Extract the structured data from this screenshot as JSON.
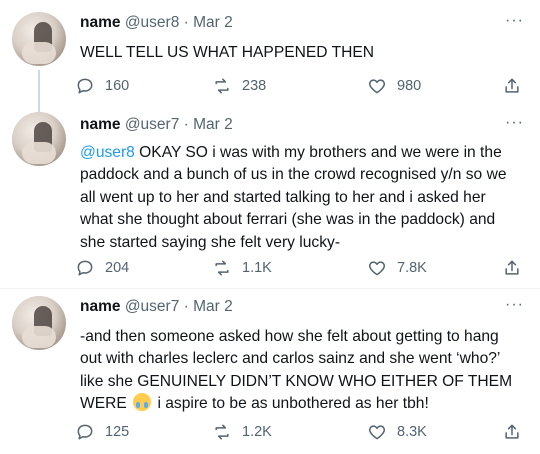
{
  "tweets": [
    {
      "name": "name",
      "handle": "@user8",
      "dot": "·",
      "date": "Mar 2",
      "text": "WELL TELL US WHAT HAPPENED THEN",
      "replies": "160",
      "retweets": "238",
      "likes": "980"
    },
    {
      "name": "name",
      "handle": "@user7",
      "dot": "·",
      "date": "Mar 2",
      "mention": "@user8",
      "text": " OKAY SO i was with my brothers and we were in the paddock and a bunch of us in the crowd recognised y/n so we all went up to her and started talking to her and i asked her what she thought about ferrari (she was in the paddock) and she started saying she felt very lucky-",
      "replies": "204",
      "retweets": "1.1K",
      "likes": "7.8K"
    },
    {
      "name": "name",
      "handle": "@user7",
      "dot": "·",
      "date": "Mar 2",
      "text": "-and then someone asked how she felt about getting to hang out with charles leclerc and carlos sainz and she went ‘who?’ like she GENUINELY DIDN’T KNOW WHO EITHER OF THEM WERE",
      "emoji": "loudly-crying-face-emoji",
      "text_after": " i aspire to be as unbothered as her tbh!",
      "replies": "125",
      "retweets": "1.2K",
      "likes": "8.3K"
    }
  ],
  "more_glyph": "···",
  "colors": {
    "link": "#1d9bf0",
    "muted": "#536471",
    "text": "#0f1419",
    "thread_line": "#cfd9de"
  },
  "icons": [
    "reply-icon",
    "retweet-icon",
    "like-icon",
    "share-icon",
    "more-icon"
  ]
}
